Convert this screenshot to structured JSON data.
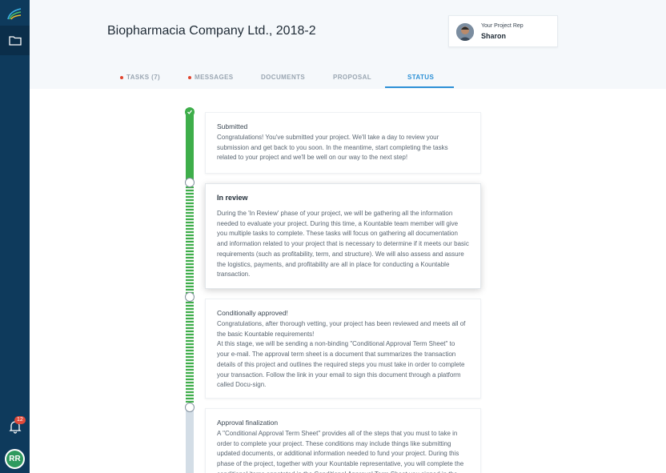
{
  "project": {
    "title": "Biopharmacia Company Ltd., 2018-2"
  },
  "rep": {
    "label": "Your Project Rep",
    "name": "Sharon"
  },
  "notifications": {
    "count": "12"
  },
  "user": {
    "initials": "RR"
  },
  "tabs": [
    {
      "label": "TASKS (7)",
      "has_dot": true
    },
    {
      "label": "MESSAGES",
      "has_dot": true
    },
    {
      "label": "DOCUMENTS",
      "has_dot": false
    },
    {
      "label": "PROPOSAL",
      "has_dot": false
    },
    {
      "label": "STATUS",
      "active": true
    }
  ],
  "steps": [
    {
      "title": "Submitted",
      "body": "Congratulations! You've submitted your project. We'll take a day to review your submission and get back to you soon. In the meantime, start completing the tasks related to your project and we'll be well on our way to the next step!"
    },
    {
      "title": "In review",
      "body": "During the 'In Review' phase of your project, we will be gathering all the information needed to evaluate your project. During this time, a Kountable team member will give you multiple tasks to complete. These tasks will focus on gathering all documentation and information related to your project that is necessary to determine if it meets our basic requirements (such as profitability, term, and structure). We will also assess and assure the logistics, payments, and profitability are all in place for conducting a Kountable transaction."
    },
    {
      "title": "Conditionally approved!",
      "body": "Congratulations, after thorough vetting, your project has been reviewed and meets all of the basic Kountable requirements!",
      "body2": "At this stage, we will be sending a non-binding \"Conditional Approval Term Sheet\" to your e-mail. The approval term sheet is a document that summarizes the transaction details of this project and outlines the required steps you must take in order to complete your transaction. Follow the link in your email to sign this document through a platform called Docu-sign."
    },
    {
      "title": "Approval finalization",
      "body": "A \"Conditional Approval Term Sheet\" provides all of the steps that you must to take in order to complete your project. These conditions may include things like submitting updated documents, or additional information needed to fund your project. During this phase of the project, together with your Kountable representative, you will complete the conditional items annotated in the Conditional Approval Term Sheet you signed in the"
    }
  ]
}
